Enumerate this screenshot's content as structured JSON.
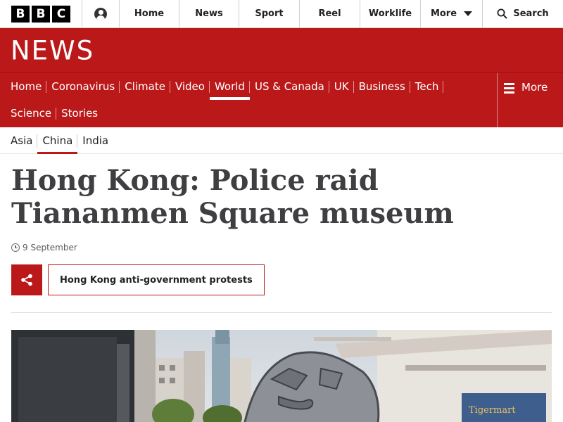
{
  "brand": {
    "bbc": [
      "B",
      "B",
      "C"
    ],
    "news_title": "NEWS"
  },
  "topnav": {
    "items": [
      "Home",
      "News",
      "Sport",
      "Reel",
      "Worklife"
    ],
    "more": "More",
    "search": "Search"
  },
  "secnav": {
    "row1": [
      "Home",
      "Coronavirus",
      "Climate",
      "Video",
      "World",
      "US & Canada",
      "UK",
      "Business",
      "Tech"
    ],
    "row2": [
      "Science",
      "Stories"
    ],
    "active": "World",
    "more": "More"
  },
  "subnav": {
    "items": [
      "Asia",
      "China",
      "India"
    ],
    "active": "China"
  },
  "article": {
    "headline": "Hong Kong: Police raid Tiananmen Square museum",
    "date": "9 September",
    "topic": "Hong Kong anti-government protests"
  },
  "colors": {
    "brand_red": "#bb1919",
    "headline": "#3f3f42"
  },
  "icons": {
    "share": "share-icon",
    "clock": "clock-icon",
    "search": "search-icon",
    "menu": "hamburger-icon",
    "account": "account-icon"
  }
}
